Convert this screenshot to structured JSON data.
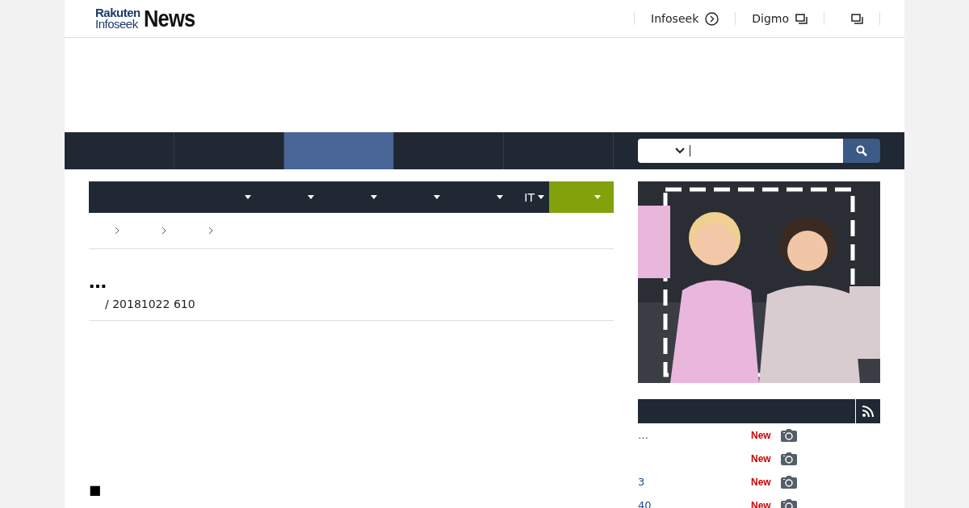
{
  "logo": {
    "top": "Rakuten",
    "bottom": "Infoseek",
    "main": "News"
  },
  "header_links": [
    {
      "label": "Infoseek",
      "kind": "circle"
    },
    {
      "label": "Digmo",
      "kind": "window"
    },
    {
      "kind": "window"
    }
  ],
  "nav_tabs": [
    {
      "selected": false
    },
    {
      "selected": false
    },
    {
      "selected": true
    },
    {
      "selected": false
    },
    {
      "selected": false
    }
  ],
  "search": {
    "cursor": true
  },
  "categories": [
    {
      "selected": false
    },
    {
      "selected": false
    },
    {
      "selected": false
    },
    {
      "selected": false
    },
    {
      "selected": false
    },
    {
      "label": "IT",
      "selected": false
    },
    {
      "selected": true
    }
  ],
  "article": {
    "title": "…",
    "meta": "/ 20181022 610",
    "bullet": "■"
  },
  "sidebar": {
    "news": [
      {
        "title": "…",
        "badge": "New"
      },
      {
        "badge": "New"
      },
      {
        "title": "3",
        "badge": "New"
      },
      {
        "title": "40",
        "badge": "New"
      }
    ]
  }
}
